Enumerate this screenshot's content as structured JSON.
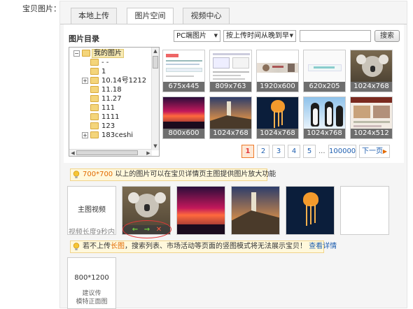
{
  "field": {
    "label": "宝贝图片：",
    "required_mark": "*"
  },
  "tabs": [
    {
      "label": "本地上传"
    },
    {
      "label": "图片空间"
    },
    {
      "label": "视频中心"
    }
  ],
  "directory": {
    "title": "图片目录",
    "root": "我的图片",
    "items": [
      "- -",
      "1",
      "10.14号1212",
      "11.18",
      "11.27",
      "111",
      "1111",
      "123",
      "183ceshi"
    ]
  },
  "filters": {
    "platform": "PC端图片",
    "sort": "按上传时间从晚到早",
    "search_value": "",
    "search_button": "搜索"
  },
  "thumbnails": [
    {
      "size": "675x445",
      "type": "screenshot-doc"
    },
    {
      "size": "809x763",
      "type": "screenshot-doc"
    },
    {
      "size": "1920x600",
      "type": "banner"
    },
    {
      "size": "620x205",
      "type": "banner-light"
    },
    {
      "size": "1024x768",
      "type": "koala"
    },
    {
      "size": "800x600",
      "type": "sunset"
    },
    {
      "size": "1024x768",
      "type": "lighthouse"
    },
    {
      "size": "1024x768",
      "type": "jellyfish"
    },
    {
      "size": "1024x768",
      "type": "penguins"
    },
    {
      "size": "1024x512",
      "type": "webpage"
    }
  ],
  "pagination": {
    "pages": [
      "1",
      "2",
      "3",
      "4",
      "5"
    ],
    "current": "1",
    "ellipsis": "...",
    "last": "100000",
    "next": "下一页"
  },
  "tip_zoom": {
    "size": "700*700",
    "text": "以上的图片可以在宝贝详情页主图提供图片放大功能"
  },
  "main_images": {
    "video_slot": {
      "title": "主图视频",
      "caption": "视频长度9秒内"
    },
    "slots": [
      "koala",
      "sunset",
      "lighthouse",
      "jellyfish",
      "empty"
    ]
  },
  "tip_long": {
    "text_pre": "若不上传",
    "highlight": "长图",
    "text_post": "，搜索列表、市场活动等页面的竖图模式将无法展示宝贝！",
    "link": "查看详情"
  },
  "portrait_slot": {
    "size": "800*1200",
    "line1": "建议传",
    "line2": "模特正面图"
  },
  "colors": {
    "accent": "#e4393c",
    "link": "#1f5fb0",
    "tip_bg": "#fff8dc"
  }
}
